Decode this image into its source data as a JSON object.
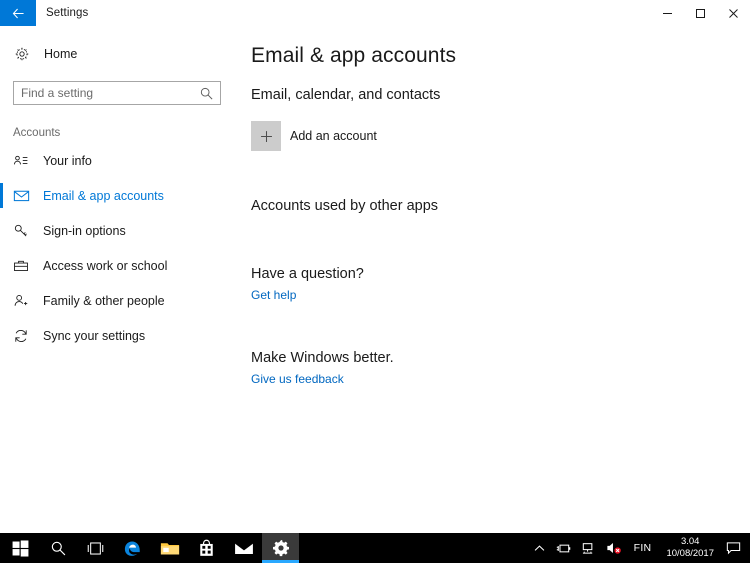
{
  "window": {
    "title": "Settings",
    "back_icon": "back-arrow-icon",
    "minimize_label": "─",
    "maximize_label": "❐",
    "close_label": "✕",
    "accent_color": "#0078d7"
  },
  "sidebar": {
    "home_label": "Home",
    "search": {
      "placeholder": "Find a setting",
      "value": ""
    },
    "group_label": "Accounts",
    "items": [
      {
        "label": "Your info",
        "icon": "your-info-icon",
        "active": false
      },
      {
        "label": "Email & app accounts",
        "icon": "envelope-icon",
        "active": true
      },
      {
        "label": "Sign-in options",
        "icon": "key-icon",
        "active": false
      },
      {
        "label": "Access work or school",
        "icon": "briefcase-icon",
        "active": false
      },
      {
        "label": "Family & other people",
        "icon": "person-add-icon",
        "active": false
      },
      {
        "label": "Sync your settings",
        "icon": "sync-icon",
        "active": false
      }
    ]
  },
  "main": {
    "page_title": "Email & app accounts",
    "section_email_calendar": "Email, calendar, and contacts",
    "add_account_label": "Add an account",
    "add_account_icon": "plus-icon",
    "section_other_apps": "Accounts used by other apps",
    "section_question": "Have a question?",
    "get_help_link": "Get help",
    "section_feedback": "Make Windows better.",
    "feedback_link": "Give us feedback",
    "link_color": "#0067c0"
  },
  "taskbar": {
    "items": [
      {
        "name": "start-button",
        "icon": "windows-logo-icon",
        "active": false
      },
      {
        "name": "search-button",
        "icon": "search-icon",
        "active": false
      },
      {
        "name": "task-view-button",
        "icon": "task-view-icon",
        "active": false
      },
      {
        "name": "edge-button",
        "icon": "edge-icon",
        "active": false
      },
      {
        "name": "file-explorer-button",
        "icon": "folder-icon",
        "active": false
      },
      {
        "name": "store-button",
        "icon": "store-bag-icon",
        "active": false
      },
      {
        "name": "mail-button",
        "icon": "mail-envelope-icon",
        "active": false
      },
      {
        "name": "settings-button",
        "icon": "gear-icon",
        "active": true
      }
    ],
    "tray": {
      "show_hidden_icon": "chevron-up-icon",
      "battery_icon": "battery-plug-icon",
      "network_icon": "network-icon",
      "volume_icon": "volume-muted-icon",
      "language": "FIN"
    },
    "clock": {
      "time": "3.04",
      "date": "10/08/2017"
    },
    "action_center_icon": "action-center-icon"
  }
}
